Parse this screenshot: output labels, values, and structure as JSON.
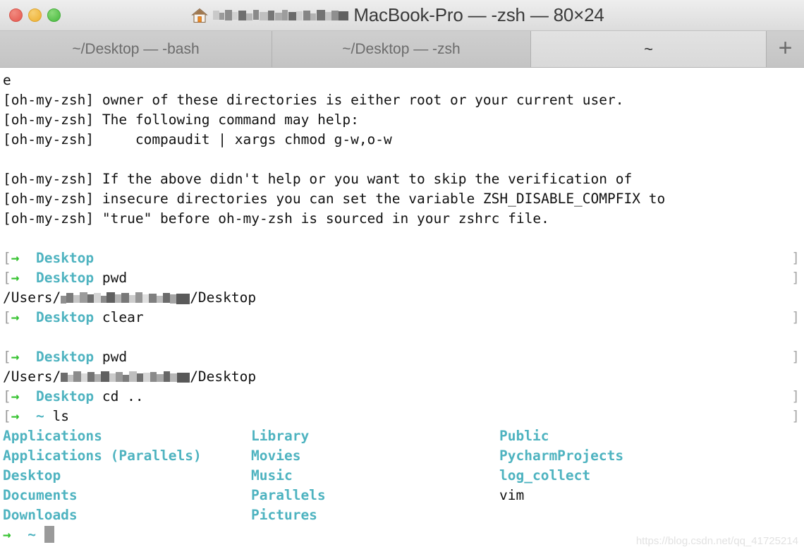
{
  "window": {
    "title_suffix": "MacBook-Pro — -zsh — 80×24",
    "home_icon": "home-icon",
    "traffic_lights": [
      "close-button",
      "minimize-button",
      "zoom-button"
    ]
  },
  "tabs": [
    {
      "label": "~/Desktop — -bash",
      "active": false
    },
    {
      "label": "~/Desktop — -zsh",
      "active": false
    },
    {
      "label": "~",
      "active": true
    }
  ],
  "new_tab_label": "+",
  "terminal": {
    "prompt_bracket_left": "[",
    "prompt_bracket_right": "]",
    "prompt_arrow": "→",
    "cursor": "block-cursor",
    "lines": [
      {
        "type": "plain",
        "text": "e"
      },
      {
        "type": "plain",
        "text": "[oh-my-zsh] owner of these directories is either root or your current user."
      },
      {
        "type": "plain",
        "text": "[oh-my-zsh] The following command may help:"
      },
      {
        "type": "plain",
        "text": "[oh-my-zsh]     compaudit | xargs chmod g-w,o-w"
      },
      {
        "type": "plain",
        "text": ""
      },
      {
        "type": "plain",
        "text": "[oh-my-zsh] If the above didn't help or you want to skip the verification of"
      },
      {
        "type": "plain",
        "text": "[oh-my-zsh] insecure directories you can set the variable ZSH_DISABLE_COMPFIX to"
      },
      {
        "type": "plain",
        "text": "[oh-my-zsh] \"true\" before oh-my-zsh is sourced in your zshrc file."
      },
      {
        "type": "plain",
        "text": ""
      },
      {
        "type": "prompt",
        "cwd": "Desktop",
        "command": ""
      },
      {
        "type": "prompt",
        "cwd": "Desktop",
        "command": "pwd"
      },
      {
        "type": "path",
        "prefix": "/Users/",
        "redacted": true,
        "suffix": "/Desktop"
      },
      {
        "type": "prompt",
        "cwd": "Desktop",
        "command": "clear"
      },
      {
        "type": "plain",
        "text": ""
      },
      {
        "type": "prompt",
        "cwd": "Desktop",
        "command": "pwd"
      },
      {
        "type": "path",
        "prefix": "/Users/",
        "redacted": true,
        "suffix": "/Desktop"
      },
      {
        "type": "prompt",
        "cwd": "Desktop",
        "command": "cd .."
      },
      {
        "type": "prompt",
        "cwd": "~",
        "command": "ls"
      }
    ],
    "ls_output": {
      "rows": [
        [
          {
            "name": "Applications",
            "kind": "dir"
          },
          {
            "name": "Library",
            "kind": "dir"
          },
          {
            "name": "Public",
            "kind": "dir"
          }
        ],
        [
          {
            "name": "Applications (Parallels)",
            "kind": "dir"
          },
          {
            "name": "Movies",
            "kind": "dir"
          },
          {
            "name": "PycharmProjects",
            "kind": "dir"
          }
        ],
        [
          {
            "name": "Desktop",
            "kind": "dir"
          },
          {
            "name": "Music",
            "kind": "dir"
          },
          {
            "name": "log_collect",
            "kind": "dir"
          }
        ],
        [
          {
            "name": "Documents",
            "kind": "dir"
          },
          {
            "name": "Parallels",
            "kind": "dir"
          },
          {
            "name": "vim",
            "kind": "file"
          }
        ],
        [
          {
            "name": "Downloads",
            "kind": "dir"
          },
          {
            "name": "Pictures",
            "kind": "dir"
          },
          {
            "name": "",
            "kind": "file"
          }
        ]
      ]
    },
    "final_prompt": {
      "cwd": "~"
    }
  },
  "watermark": "https://blog.csdn.net/qq_41725214",
  "colors": {
    "cyan": "#4eb3c0",
    "green": "#35c22f",
    "text": "#111111",
    "bracket": "#9b9b9b"
  }
}
